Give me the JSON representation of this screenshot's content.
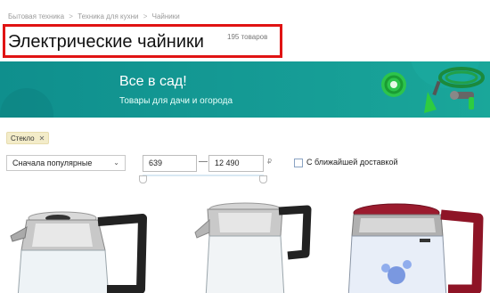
{
  "breadcrumb": {
    "items": [
      "Бытовая техника",
      "Техника для кухни",
      "Чайники"
    ],
    "separator": ">"
  },
  "page": {
    "title": "Электрические чайники",
    "count": "195 товаров"
  },
  "banner": {
    "heading": "Все в сад!",
    "subheading": "Товары для дачи и огорода",
    "colors": {
      "bg": "#129591",
      "text": "#ffffff",
      "accent": "#2ecc40"
    }
  },
  "filters": {
    "chip_label": "Стекло",
    "chip_remove": "✕"
  },
  "sort": {
    "selected": "Сначала популярные",
    "chevron": "⌄"
  },
  "price": {
    "min": "639",
    "separator": "—",
    "max": "12 490",
    "currency": "₽"
  },
  "delivery": {
    "label": "С ближайшей доставкой",
    "checked": false
  },
  "products": [
    {
      "name": "kettle-black-steel"
    },
    {
      "name": "kettle-steel-glass"
    },
    {
      "name": "kettle-red-glass"
    }
  ]
}
